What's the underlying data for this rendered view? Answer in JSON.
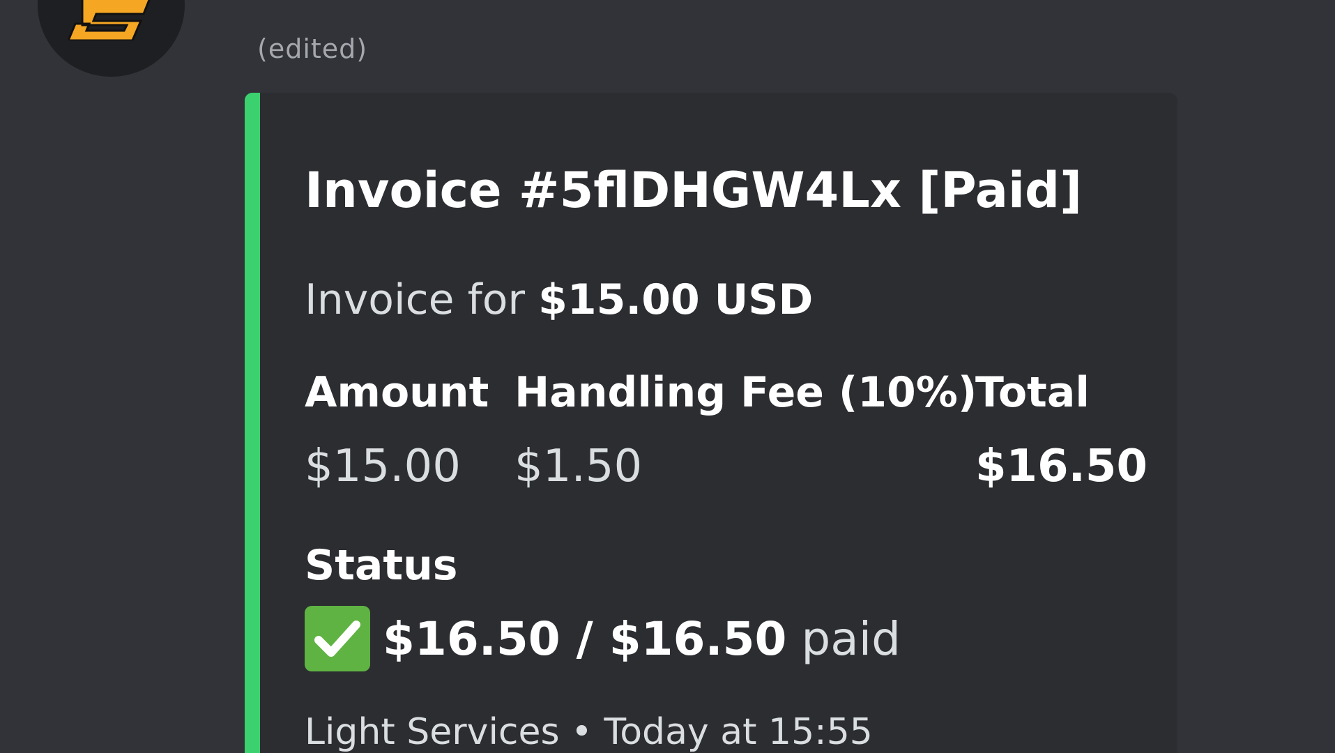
{
  "message": {
    "edited_label": "(edited)"
  },
  "embed": {
    "accent_color": "#3bd16f",
    "title": "Invoice #5flDHGW4Lx [Paid]",
    "description_prefix": "Invoice for ",
    "description_amount": "$15.00 USD",
    "fields": [
      {
        "name": "Amount",
        "value": "$15.00"
      },
      {
        "name": "Handling Fee (10%)",
        "value": "$1.50"
      },
      {
        "name": "Total",
        "value": "$16.50"
      }
    ],
    "status": {
      "name": "Status",
      "icon": "check-mark-button-icon",
      "paid_amount": "$16.50",
      "separator": " / ",
      "total_amount": "$16.50",
      "suffix": " paid"
    },
    "footer": {
      "service": "Light Services",
      "separator": " • ",
      "timestamp": "Today at 15:55"
    }
  }
}
